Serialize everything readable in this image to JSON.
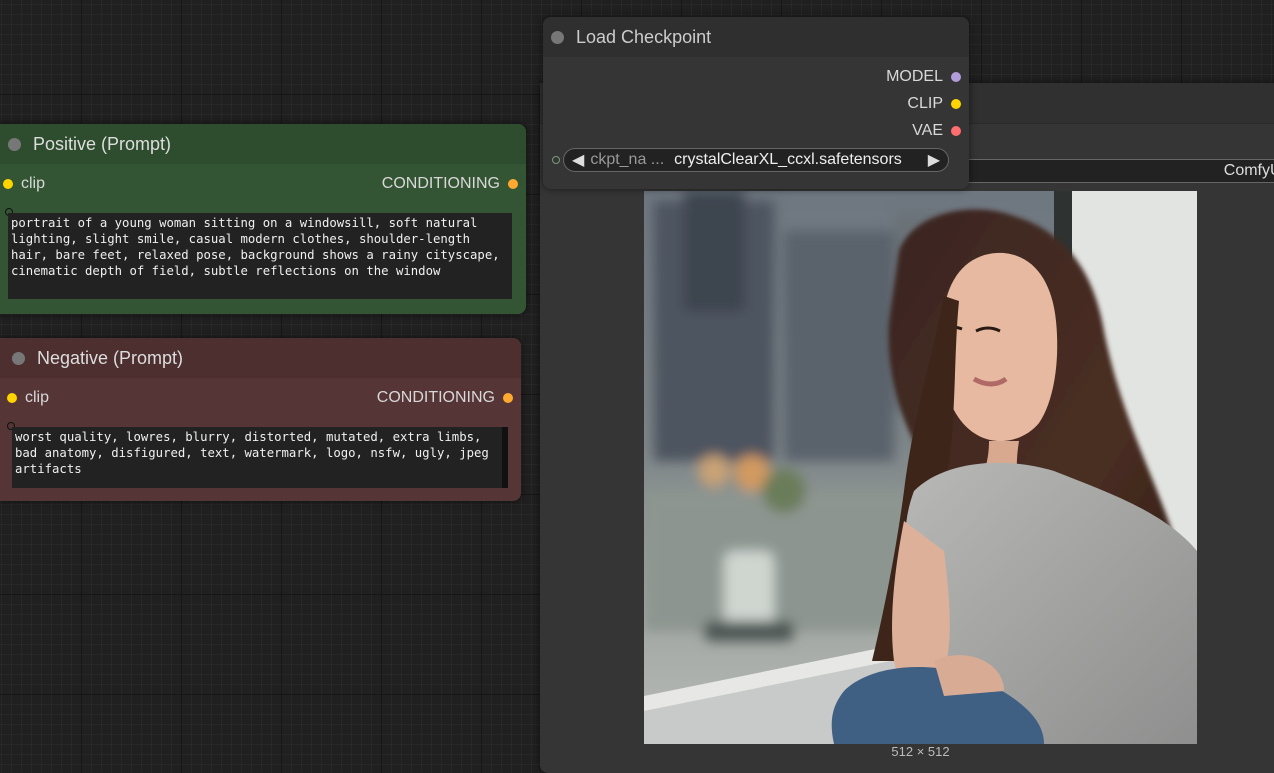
{
  "positive_node": {
    "title": "Positive (Prompt)",
    "input_label": "clip",
    "output_label": "CONDITIONING",
    "text": "portrait of a young woman sitting on a windowsill, soft natural lighting, slight smile, casual modern clothes, shoulder-length hair, bare feet, relaxed pose, background shows a rainy cityscape, cinematic depth of field, subtle reflections on the window"
  },
  "negative_node": {
    "title": "Negative (Prompt)",
    "input_label": "clip",
    "output_label": "CONDITIONING",
    "text": "worst quality, lowres, blurry, distorted, mutated, extra limbs, bad anatomy, disfigured, text, watermark, logo, nsfw, ugly, jpeg artifacts"
  },
  "load_checkpoint_node": {
    "title": "Load Checkpoint",
    "outputs": [
      {
        "label": "MODEL",
        "color": "#b39ddb"
      },
      {
        "label": "CLIP",
        "color": "#ffd500"
      },
      {
        "label": "VAE",
        "color": "#ff6e6e"
      }
    ],
    "widget": {
      "name": "ckpt_na ...",
      "value": "crystalClearXL_ccxl.safetensors",
      "left_arrow": "◀",
      "right_arrow": "▶"
    }
  },
  "preview_node": {
    "filename_prefix": "ComfyUI",
    "image_size": "512 × 512"
  },
  "colors": {
    "clip_slot": "#ffd500",
    "conditioning_slot": "#ffa931",
    "positive_body": "#335533",
    "negative_body": "#553535"
  }
}
